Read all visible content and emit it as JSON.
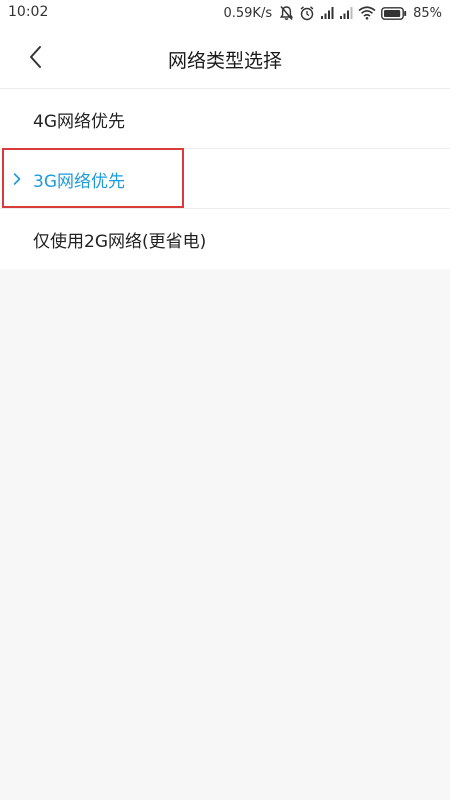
{
  "status_bar": {
    "time": "10:02",
    "net_speed": "0.59K/s",
    "battery_percent": "85%",
    "icons": [
      "mute-icon",
      "alarm-icon",
      "signal-icon",
      "signal-icon",
      "wifi-icon",
      "battery-icon"
    ]
  },
  "header": {
    "back_icon": "chevron-left-icon",
    "title": "网络类型选择"
  },
  "options": [
    {
      "label": "4G网络优先",
      "selected": false
    },
    {
      "label": "3G网络优先",
      "selected": true
    },
    {
      "label": "仅使用2G网络(更省电)",
      "selected": false
    }
  ],
  "colors": {
    "accent": "#1d9bdc",
    "highlight_border": "#d93a3a",
    "background": "#f7f7f7",
    "surface": "#ffffff"
  }
}
